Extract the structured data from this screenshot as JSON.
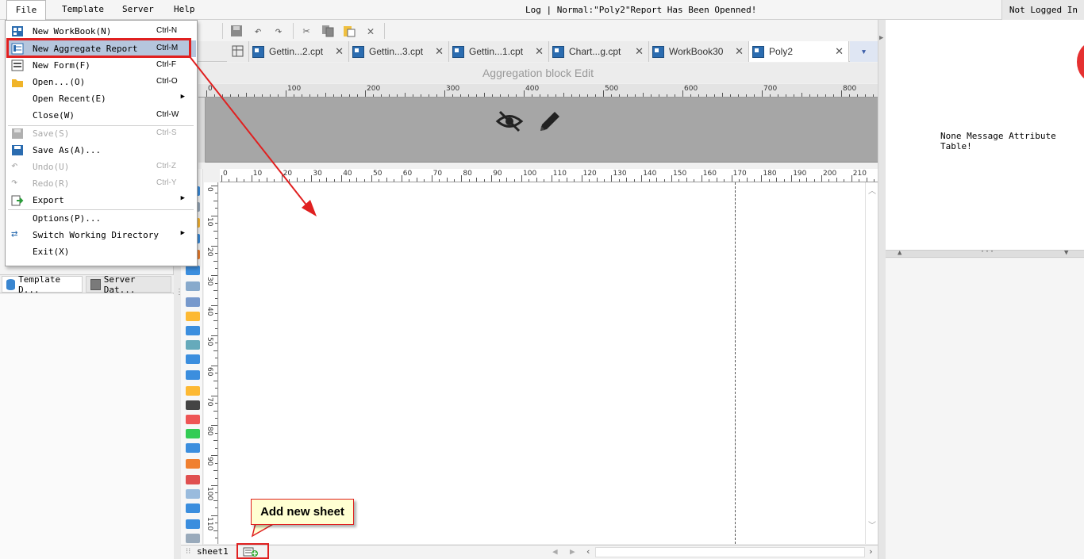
{
  "menubar": {
    "file": "File",
    "template": "Template",
    "server": "Server",
    "help": "Help",
    "log_message": "Log | Normal:\"Poly2\"Report Has Been Openned!",
    "login_status": "Not Logged In"
  },
  "file_menu": {
    "new_workbook": {
      "label": "New WorkBook(N)",
      "shortcut": "Ctrl-N"
    },
    "new_aggregate": {
      "label": "New Aggregate Report",
      "shortcut": "Ctrl-M"
    },
    "new_form": {
      "label": "New Form(F)",
      "shortcut": "Ctrl-F"
    },
    "open": {
      "label": "Open...(O)",
      "shortcut": "Ctrl-O"
    },
    "open_recent": {
      "label": "Open Recent(E)"
    },
    "close": {
      "label": "Close(W)",
      "shortcut": "Ctrl-W"
    },
    "save": {
      "label": "Save(S)",
      "shortcut": "Ctrl-S"
    },
    "save_as": {
      "label": "Save As(A)..."
    },
    "undo": {
      "label": "Undo(U)",
      "shortcut": "Ctrl-Z"
    },
    "redo": {
      "label": "Redo(R)",
      "shortcut": "Ctrl-Y"
    },
    "export": {
      "label": "Export"
    },
    "options": {
      "label": "Options(P)..."
    },
    "switch_dir": {
      "label": "Switch Working Directory"
    },
    "exit": {
      "label": "Exit(X)"
    }
  },
  "left_panel": {
    "tab_template": "Template D...",
    "tab_server": "Server Dat..."
  },
  "tabs": [
    {
      "label": "Gettin...2.cpt"
    },
    {
      "label": "Gettin...3.cpt"
    },
    {
      "label": "Gettin...1.cpt"
    },
    {
      "label": "Chart...g.cpt"
    },
    {
      "label": "WorkBook30"
    },
    {
      "label": "Poly2"
    }
  ],
  "editor": {
    "agg_header": "Aggregation block Edit",
    "ruler1_labels": [
      "0",
      "100",
      "200",
      "300",
      "400",
      "500",
      "600",
      "700",
      "800"
    ],
    "ruler2_labels": [
      "0",
      "10",
      "20",
      "30",
      "40",
      "50",
      "60",
      "70",
      "80",
      "90",
      "100",
      "110",
      "120",
      "130",
      "140",
      "150",
      "160",
      "170",
      "180",
      "190",
      "200",
      "210"
    ],
    "vruler_labels": [
      "0",
      "10",
      "20",
      "30",
      "40",
      "50",
      "60",
      "70",
      "80",
      "90",
      "100",
      "110"
    ],
    "sheet_name": "sheet1"
  },
  "right_panel": {
    "message": "None Message Attribute Table!"
  },
  "annotation": {
    "callout": "Add new sheet"
  },
  "colors": {
    "highlight_red": "#e02020",
    "menu_highlight": "#b5c6dd",
    "callout_bg": "#ffffd2"
  }
}
